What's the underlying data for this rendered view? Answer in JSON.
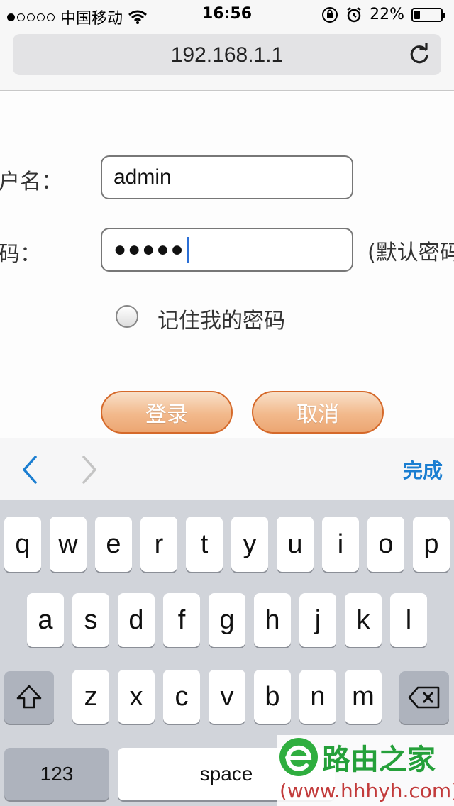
{
  "status_bar": {
    "carrier": "中国移动",
    "time": "16:56",
    "battery": "22%",
    "battery_level": 0.22,
    "signal_bars": 1
  },
  "browser": {
    "url": "192.168.1.1"
  },
  "login_form": {
    "username_label": "户名：",
    "username_value": "admin",
    "password_label": "码：",
    "password_value": "●●●●●",
    "password_hint": "(默认密码",
    "remember_label": "记住我的密码",
    "login_button": "登录",
    "cancel_button": "取消"
  },
  "accessory_bar": {
    "done_label": "完成"
  },
  "keyboard": {
    "row1": [
      "q",
      "w",
      "e",
      "r",
      "t",
      "y",
      "u",
      "i",
      "o",
      "p"
    ],
    "row2": [
      "a",
      "s",
      "d",
      "f",
      "g",
      "h",
      "j",
      "k",
      "l"
    ],
    "row3": [
      "z",
      "x",
      "c",
      "v",
      "b",
      "n",
      "m"
    ],
    "numbers_key": "123",
    "space_key": "space"
  },
  "watermark": {
    "title": "路由之家",
    "url": "(www.hhhyh.com)"
  },
  "colors": {
    "button_border": "#d5692a",
    "accent_blue": "#1b7ed1",
    "watermark_green": "#25a03a"
  }
}
